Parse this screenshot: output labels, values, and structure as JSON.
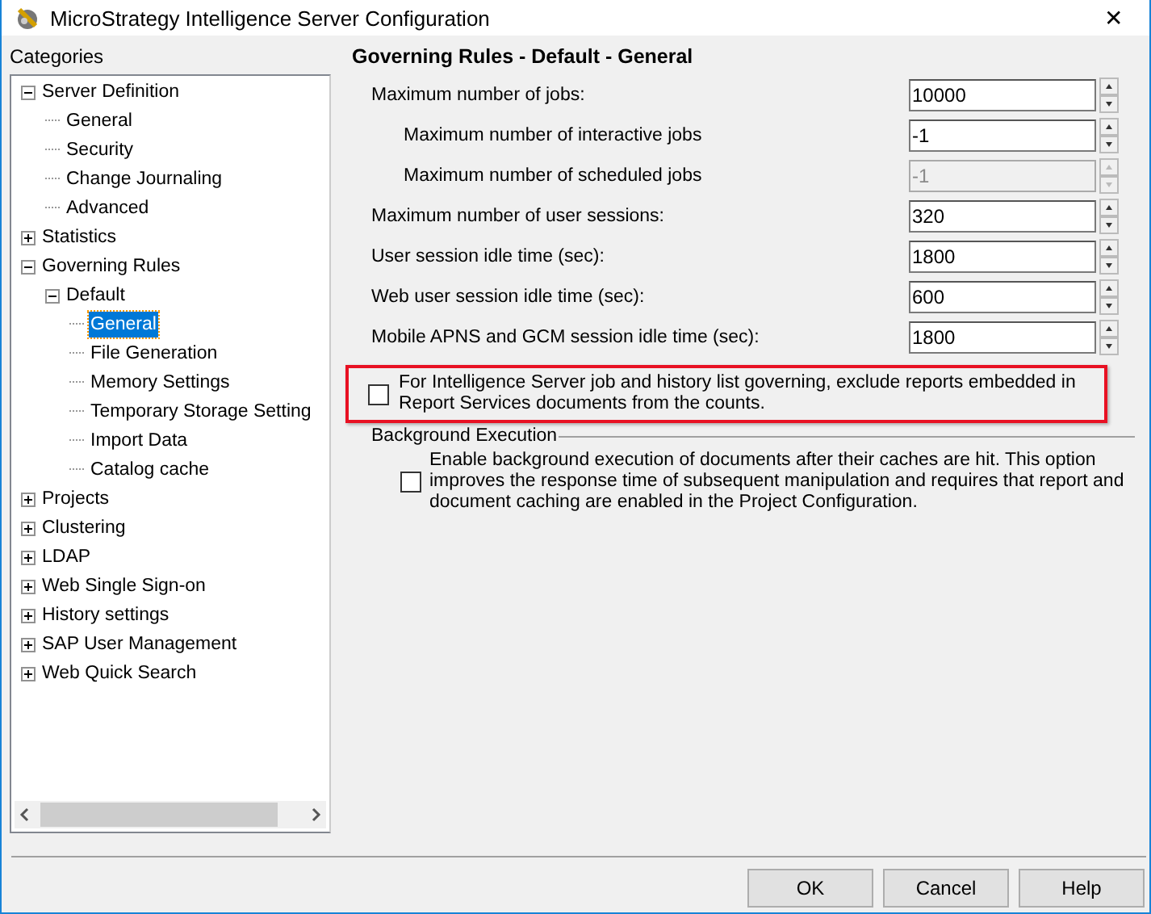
{
  "window": {
    "title": "MicroStrategy Intelligence Server Configuration",
    "close": "✕"
  },
  "categories": {
    "title": "Categories",
    "items": [
      {
        "label": "Server Definition",
        "expanded": true,
        "selected": false,
        "children": [
          {
            "label": "General",
            "selected": false
          },
          {
            "label": "Security",
            "selected": false
          },
          {
            "label": "Change Journaling",
            "selected": false
          },
          {
            "label": "Advanced",
            "selected": false
          }
        ]
      },
      {
        "label": "Statistics",
        "expanded": false,
        "selected": false
      },
      {
        "label": "Governing Rules",
        "expanded": true,
        "selected": false,
        "children": [
          {
            "label": "Default",
            "expanded": true,
            "selected": false,
            "children": [
              {
                "label": "General",
                "selected": true
              },
              {
                "label": "File Generation",
                "selected": false
              },
              {
                "label": "Memory Settings",
                "selected": false
              },
              {
                "label": "Temporary Storage Setting",
                "selected": false
              },
              {
                "label": "Import Data",
                "selected": false
              },
              {
                "label": "Catalog cache",
                "selected": false
              }
            ]
          }
        ]
      },
      {
        "label": "Projects",
        "expanded": false,
        "selected": false
      },
      {
        "label": "Clustering",
        "expanded": false,
        "selected": false
      },
      {
        "label": "LDAP",
        "expanded": false,
        "selected": false
      },
      {
        "label": "Web Single Sign-on",
        "expanded": false,
        "selected": false
      },
      {
        "label": "History settings",
        "expanded": false,
        "selected": false
      },
      {
        "label": "SAP User Management",
        "expanded": false,
        "selected": false
      },
      {
        "label": "Web Quick Search",
        "expanded": false,
        "selected": false
      }
    ]
  },
  "heading": "Governing Rules - Default - General",
  "fields": [
    {
      "label": "Maximum number of jobs:",
      "value": "10000",
      "disabled": false,
      "children": [
        {
          "label": "Maximum number of interactive jobs",
          "value": "-1",
          "disabled": false
        },
        {
          "label": "Maximum number of scheduled jobs",
          "value": "-1",
          "disabled": true
        }
      ]
    },
    {
      "label": "Maximum number of user sessions:",
      "value": "320",
      "disabled": false
    },
    {
      "label": "User session idle time (sec):",
      "value": "1800",
      "disabled": false
    },
    {
      "label": "Web user session idle time (sec):",
      "value": "600",
      "disabled": false
    },
    {
      "label": "Mobile APNS and GCM session idle time (sec):",
      "value": "1800",
      "disabled": false
    }
  ],
  "exclude_option": {
    "label": "For Intelligence Server job and history list governing, exclude reports embedded in Report Services documents from the counts.",
    "checked": false,
    "highlighted": true
  },
  "background_execution": {
    "title": "Background Execution",
    "option": {
      "label": "Enable background execution of documents after their caches are hit. This option improves the response time of subsequent manipulation and requires that report and document caching are enabled in the Project Configuration.",
      "checked": false
    }
  },
  "buttons": [
    "OK",
    "Cancel",
    "Help"
  ]
}
